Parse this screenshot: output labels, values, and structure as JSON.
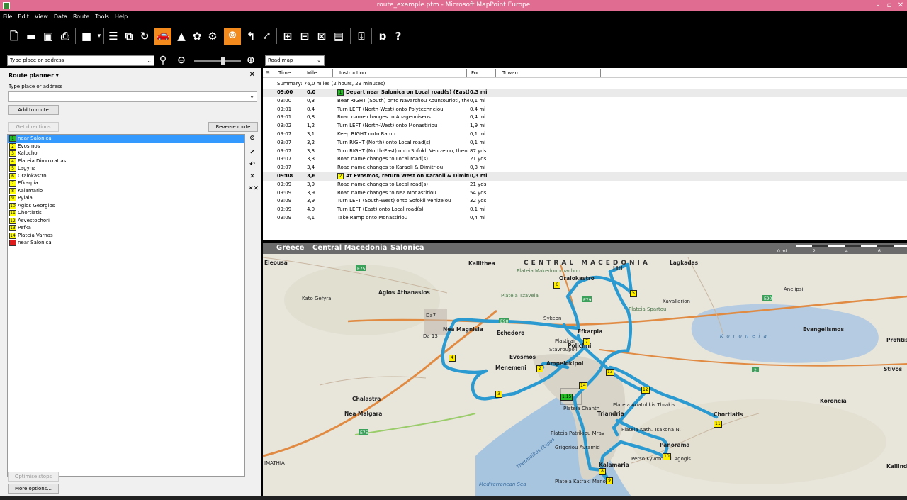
{
  "window": {
    "title": "route_example.ptm - Microsoft MapPoint Europe"
  },
  "menu": [
    "File",
    "Edit",
    "View",
    "Data",
    "Route",
    "Tools",
    "Help"
  ],
  "location_bar": {
    "placeholder": "Type place or address",
    "map_style": "Road map"
  },
  "planner": {
    "title": "Route planner",
    "input_label": "Type place or address",
    "add_button": "Add to route",
    "get_directions": "Get directions",
    "reverse_route": "Reverse route",
    "optimise_stops": "Optimise stops",
    "more_options": "More options...",
    "stops": [
      {
        "num": "1",
        "name": "near Salonica",
        "kind": "start",
        "selected": true
      },
      {
        "num": "2",
        "name": "Evosmos"
      },
      {
        "num": "3",
        "name": "Kalochori"
      },
      {
        "num": "4",
        "name": "Plateia Dimokratias"
      },
      {
        "num": "5",
        "name": "Lagyna"
      },
      {
        "num": "6",
        "name": "Oraiokastro"
      },
      {
        "num": "7",
        "name": "Efkarpia"
      },
      {
        "num": "8",
        "name": "Kalamario"
      },
      {
        "num": "9",
        "name": "Pylaia"
      },
      {
        "num": "10",
        "name": "Agios Georgios"
      },
      {
        "num": "11",
        "name": "Chortiatis"
      },
      {
        "num": "12",
        "name": "Asvestochori"
      },
      {
        "num": "13",
        "name": "Pefka"
      },
      {
        "num": "14",
        "name": "Plateia Varnas"
      },
      {
        "num": "",
        "name": "near Salonica",
        "kind": "end"
      }
    ]
  },
  "directions": {
    "headers": {
      "time": "Time",
      "mile": "Mile",
      "instruction": "Instruction",
      "for": "For",
      "toward": "Toward"
    },
    "summary": "Summary: 76,0 miles (2 hours, 29 minutes)",
    "rows": [
      {
        "time": "09:00",
        "mile": "0,0",
        "wp": "1",
        "instruction": "Depart near Salonica on Local road(s) (East)",
        "for": "0,3 mi",
        "bold": true,
        "wpkind": "start"
      },
      {
        "time": "09:00",
        "mile": "0,3",
        "instruction": "Bear RIGHT (South) onto Navarchou Kountourioti, the",
        "for": "0,1 mi"
      },
      {
        "time": "09:01",
        "mile": "0,4",
        "instruction": "Turn LEFT (North-West) onto Polytechneiou",
        "for": "0,4 mi"
      },
      {
        "time": "09:01",
        "mile": "0,8",
        "instruction": "Road name changes to Anagenniseos",
        "for": "0,4 mi"
      },
      {
        "time": "09:02",
        "mile": "1,2",
        "instruction": "Turn LEFT (North-West) onto Monastiriou",
        "for": "1,9 mi"
      },
      {
        "time": "09:07",
        "mile": "3,1",
        "instruction": "Keep RIGHT onto Ramp",
        "for": "0,1 mi"
      },
      {
        "time": "09:07",
        "mile": "3,2",
        "instruction": "Turn RIGHT (North) onto Local road(s)",
        "for": "0,1 mi"
      },
      {
        "time": "09:07",
        "mile": "3,3",
        "instruction": "Turn RIGHT (North-East) onto Sofokli Venizelou, then",
        "for": "87 yds"
      },
      {
        "time": "09:07",
        "mile": "3,3",
        "instruction": "Road name changes to Local road(s)",
        "for": "21 yds"
      },
      {
        "time": "09:07",
        "mile": "3,4",
        "instruction": "Road name changes to Karaoli & Dimitriou",
        "for": "0,3 mi"
      },
      {
        "time": "09:08",
        "mile": "3,6",
        "wp": "2",
        "instruction": "At Evosmos, return West on Karaoli & Dimitriou",
        "for": "0,3 mi",
        "bold": true
      },
      {
        "time": "09:09",
        "mile": "3,9",
        "instruction": "Road name changes to Local road(s)",
        "for": "21 yds"
      },
      {
        "time": "09:09",
        "mile": "3,9",
        "instruction": "Road name changes to Nea Monastiriou",
        "for": "54 yds"
      },
      {
        "time": "09:09",
        "mile": "3,9",
        "instruction": "Turn LEFT (South-West) onto Sofokli Venizelou",
        "for": "32 yds"
      },
      {
        "time": "09:09",
        "mile": "4,0",
        "instruction": "Turn LEFT (East) onto Local road(s)",
        "for": "0,1 mi"
      },
      {
        "time": "09:09",
        "mile": "4,1",
        "instruction": "Take Ramp onto Monastiriou",
        "for": "0,4 mi"
      }
    ]
  },
  "map": {
    "location": {
      "country": "Greece",
      "region": "Central Macedonia",
      "city": "Salonica"
    },
    "scale": [
      "0 mi",
      "2",
      "4",
      "6"
    ],
    "labels": {
      "central_macedonia": "CENTRAL MACEDONIA",
      "koroneia_lake": "Koroneia",
      "litti": "Liti",
      "lagkadas": "Lagkadas",
      "kallithea": "Kallithea",
      "plateia_makedonomachon": "Plateia Makedonomachon",
      "oraiokastro": "Oraiokastro",
      "plateia_tzavela": "Plateia Tzavela",
      "kavallarion": "Kavallarion",
      "anelipsi": "Anelipsi",
      "plateia_spartou": "Plateia Spartou",
      "evangelismos": "Evangelismos",
      "profitis": "Profitis",
      "agios_athanasios": "Agios Athanasios",
      "kato_gefyra": "Kato Gefyra",
      "eleousa": "Eleousa",
      "nea_magnisia": "Nea Magnisia",
      "echedoro": "Echedoro",
      "efkarpia": "Efkarpia",
      "polichni": "Polichni",
      "evosmos": "Evosmos",
      "menemeni": "Menemeni",
      "ampelokipoi": "Ampelokipoi",
      "stivos": "Stivos",
      "koroneia_town": "Koroneia",
      "chalastra": "Chalastra",
      "nea_malgara": "Nea Malgara",
      "chortiatis": "Chortiatis",
      "triandria": "Triandria",
      "plateia_anatolikis": "Plateia Anatolikis Thrakis",
      "plateia_kath": "Plateia Kath. Tsakona N.",
      "panorama": "Panorama",
      "kalamaria": "Kalamaria",
      "mediterranean": "Mediterranean Sea",
      "imathia": "IMATHIA",
      "kallindo": "Kallindo",
      "thermaikos": "Thermaikos Kolpos",
      "plateia_chanth": "Plateia Chanth",
      "plateia_patrikiou": "Plateia Patrikiou Mrav",
      "grigoriou": "Grigoriou Avramid",
      "plateia_katraki": "Plateia Katraki Manou",
      "perso_kyvotoraki": "Perso Kyvotoraki Agogis",
      "stavroupoli": "Stavroupoli",
      "plastirac": "Plastirai",
      "sykeon": "Sykeon",
      "da7": "Da7",
      "da13": "Da 13",
      "e75": "E75",
      "e90": "E90",
      "e79": "E79",
      "r2": "2"
    },
    "markers": [
      "1,15",
      "2",
      "3",
      "4",
      "5",
      "6",
      "7",
      "8",
      "9",
      "10",
      "11",
      "12",
      "13",
      "14"
    ],
    "route_color": "#2a9ad0"
  }
}
